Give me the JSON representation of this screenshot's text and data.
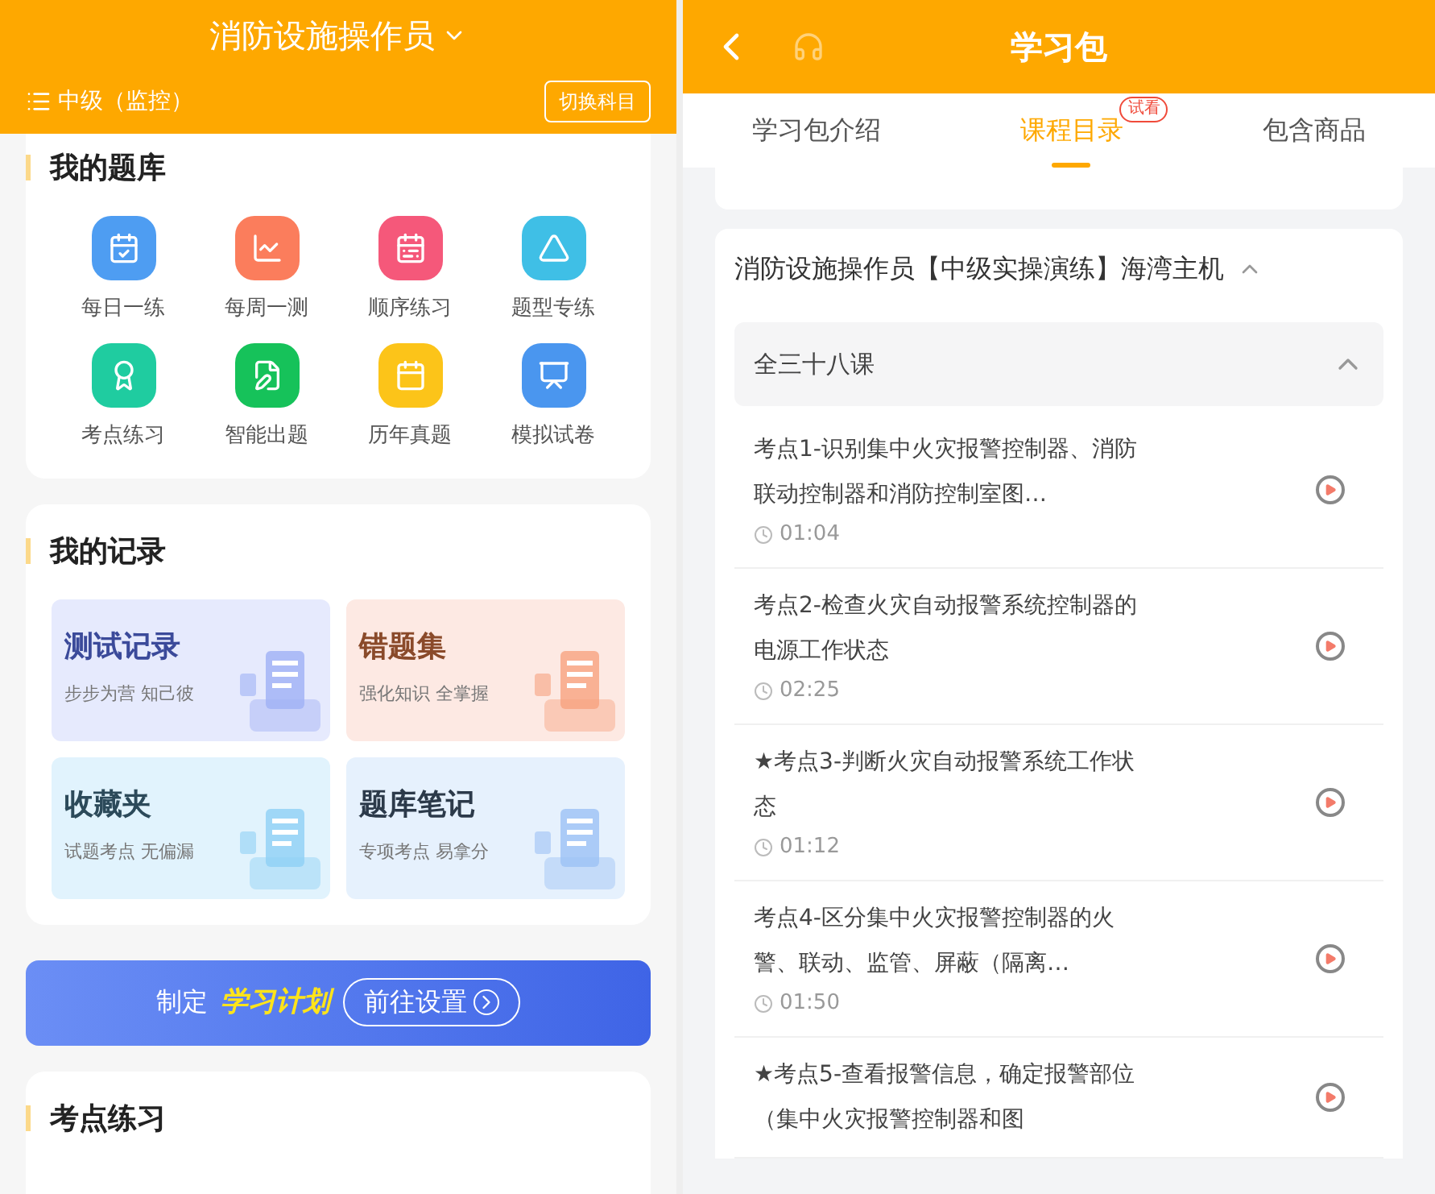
{
  "left": {
    "header": {
      "title": "消防设施操作员",
      "level": "中级（监控）",
      "switch_button": "切换科目"
    },
    "question_bank": {
      "title": "我的题库",
      "items": [
        {
          "label": "每日一练",
          "color": "#4e9df2"
        },
        {
          "label": "每周一测",
          "color": "#fb7d5c"
        },
        {
          "label": "顺序练习",
          "color": "#f5587a"
        },
        {
          "label": "题型专练",
          "color": "#3fbfe6"
        },
        {
          "label": "考点练习",
          "color": "#1fcca0"
        },
        {
          "label": "智能出题",
          "color": "#16c25a"
        },
        {
          "label": "历年真题",
          "color": "#fcc419"
        },
        {
          "label": "模拟试卷",
          "color": "#4a96ef"
        }
      ]
    },
    "records": {
      "title": "我的记录",
      "tiles": [
        {
          "title": "测试记录",
          "subtitle": "步步为营 知己彼",
          "color": "#e6eafd"
        },
        {
          "title": "错题集",
          "subtitle": "强化知识 全掌握",
          "color": "#fde9e3"
        },
        {
          "title": "收藏夹",
          "subtitle": "试题考点 无偏漏",
          "color": "#e1f3fd"
        },
        {
          "title": "题库笔记",
          "subtitle": "专项考点 易拿分",
          "color": "#e6f1fd"
        }
      ]
    },
    "banner": {
      "prefix": "制定",
      "highlight": "学习计划",
      "button": "前往设置"
    },
    "points": {
      "title": "考点练习"
    }
  },
  "right": {
    "header": {
      "title": "学习包"
    },
    "tabs": [
      {
        "label": "学习包介绍",
        "selected": false
      },
      {
        "label": "课程目录",
        "selected": true,
        "badge": "试看"
      },
      {
        "label": "包含商品",
        "selected": false
      }
    ],
    "course": {
      "title": "消防设施操作员【中级实操演练】海湾主机",
      "expanded": true,
      "section": {
        "title": "全三十八课",
        "expanded": true
      },
      "lessons": [
        {
          "title": "考点1-识别集中火灾报警控制器、消防联动控制器和消防控制室图…",
          "duration": "01:04"
        },
        {
          "title": "考点2-检查火灾自动报警系统控制器的电源工作状态",
          "duration": "02:25"
        },
        {
          "title": "★考点3-判断火灾自动报警系统工作状态",
          "duration": "01:12"
        },
        {
          "title": "考点4-区分集中火灾报警控制器的火警、联动、监管、屏蔽（隔离…",
          "duration": "01:50"
        },
        {
          "title": "★考点5-查看报警信息，确定报警部位（集中火灾报警控制器和图"
        }
      ]
    }
  }
}
